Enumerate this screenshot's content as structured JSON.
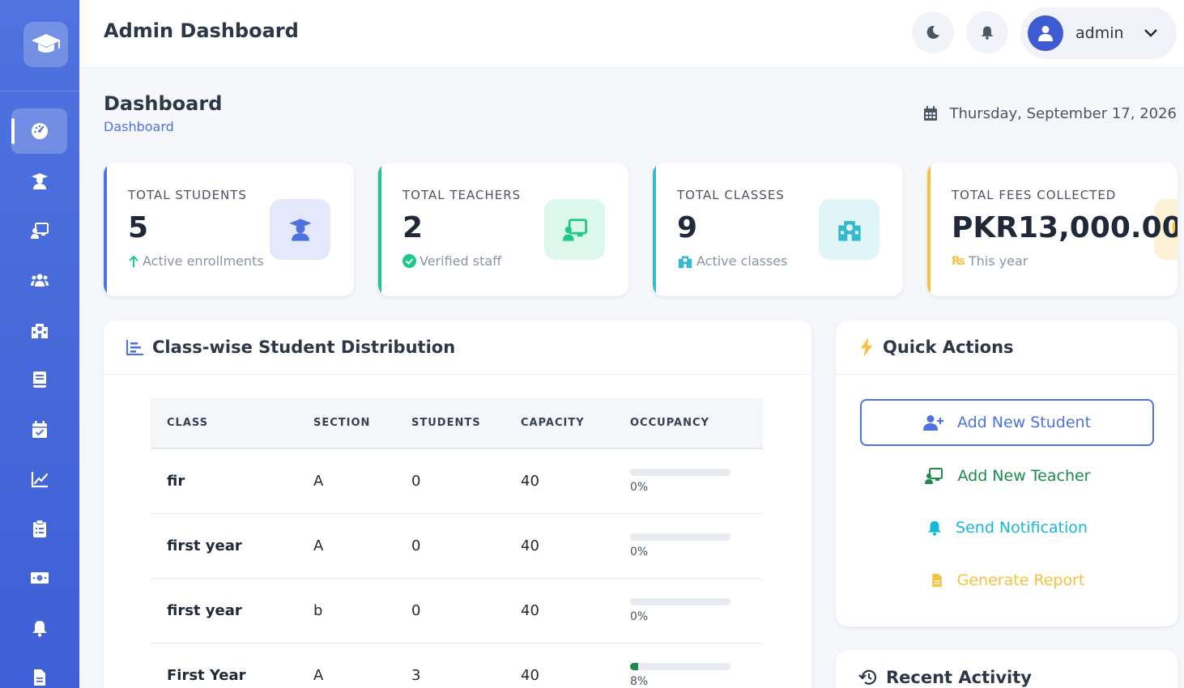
{
  "app": {
    "title": "Admin Dashboard"
  },
  "user": {
    "name": "admin"
  },
  "page": {
    "title": "Dashboard",
    "breadcrumb": "Dashboard",
    "date": "Thursday, September 17, 2026"
  },
  "sidebar": {
    "items": [
      {
        "icon": "dashboard-icon"
      },
      {
        "icon": "student-icon"
      },
      {
        "icon": "teacher-icon"
      },
      {
        "icon": "users-icon"
      },
      {
        "icon": "school-icon"
      },
      {
        "icon": "book-icon"
      },
      {
        "icon": "calendar-check-icon"
      },
      {
        "icon": "chart-line-icon"
      },
      {
        "icon": "clipboard-icon"
      },
      {
        "icon": "money-icon"
      },
      {
        "icon": "bell-icon"
      },
      {
        "icon": "file-icon"
      }
    ]
  },
  "stats": [
    {
      "label": "TOTAL STUDENTS",
      "value": "5",
      "sub": "Active enrollments",
      "color": "#4e73df",
      "icon": "student-icon"
    },
    {
      "label": "TOTAL TEACHERS",
      "value": "2",
      "sub": "Verified staff",
      "color": "#1cc88a",
      "icon": "teacher-icon"
    },
    {
      "label": "TOTAL CLASSES",
      "value": "9",
      "sub": "Active classes",
      "color": "#36b9cc",
      "icon": "school-icon"
    },
    {
      "label": "TOTAL FEES COLLECTED",
      "value": "PKR13,000.00",
      "sub": "This year",
      "color": "#f6c23e",
      "icon": "money-icon"
    }
  ],
  "distribution": {
    "title": "Class-wise Student Distribution",
    "columns": [
      "CLASS",
      "SECTION",
      "STUDENTS",
      "CAPACITY",
      "OCCUPANCY"
    ],
    "rows": [
      {
        "class": "fir",
        "section": "A",
        "students": "0",
        "capacity": "40",
        "occupancy": "0%",
        "occ_value": 0
      },
      {
        "class": "first year",
        "section": "A",
        "students": "0",
        "capacity": "40",
        "occupancy": "0%",
        "occ_value": 0
      },
      {
        "class": "first year",
        "section": "b",
        "students": "0",
        "capacity": "40",
        "occupancy": "0%",
        "occ_value": 0
      },
      {
        "class": "First Year",
        "section": "A",
        "students": "3",
        "capacity": "40",
        "occupancy": "8%",
        "occ_value": 8
      }
    ]
  },
  "quick_actions": {
    "title": "Quick Actions",
    "add_student": "Add New Student",
    "add_teacher": "Add New Teacher",
    "send_notification": "Send Notification",
    "generate_report": "Generate Report"
  },
  "recent_activity": {
    "title": "Recent Activity"
  }
}
